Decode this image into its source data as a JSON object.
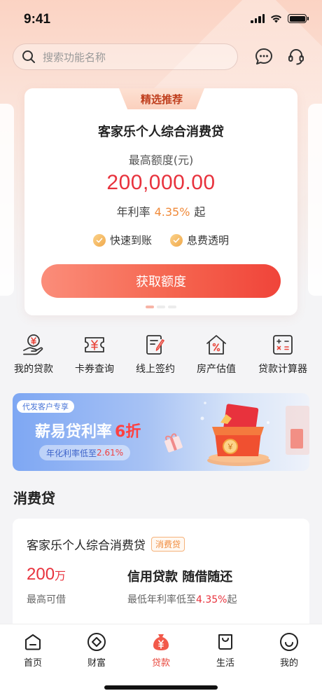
{
  "status_bar": {
    "time": "9:41"
  },
  "header": {
    "search_placeholder": "搜索功能名称",
    "icons": [
      "message-icon",
      "customer-service-icon"
    ]
  },
  "featured": {
    "ribbon": "精选推荐",
    "title": "客家乐个人综合消费贷",
    "limit_label": "最高额度(元)",
    "amount": "200,000.00",
    "rate_prefix": "年利率",
    "rate_value": "4.35%",
    "rate_suffix": "起",
    "features": [
      {
        "label": "快速到账"
      },
      {
        "label": "息费透明"
      }
    ],
    "cta_label": "获取额度",
    "page_count": 3,
    "active_page": 1
  },
  "quick_actions": [
    {
      "label": "我的贷款",
      "icon": "hand-yuan-icon"
    },
    {
      "label": "卡券查询",
      "icon": "coupon-icon"
    },
    {
      "label": "线上签约",
      "icon": "sign-document-icon"
    },
    {
      "label": "房产估值",
      "icon": "house-percent-icon"
    },
    {
      "label": "贷款计算器",
      "icon": "calculator-icon"
    }
  ],
  "banner": {
    "tag": "代发客户专享",
    "headline": "薪易贷利率",
    "discount": "6折",
    "sub_prefix": "年化利率低至",
    "sub_value": "2.61%"
  },
  "section": {
    "title": "消费贷"
  },
  "product": {
    "name": "客家乐个人综合消费贷",
    "badge": "消费贷",
    "amount": "200",
    "amount_unit": "万",
    "amount_label": "最高可借",
    "slogan": "信用贷款 随借随还",
    "rate_prefix": "最低年利率低至",
    "rate_value": "4.35%",
    "rate_suffix": "起"
  },
  "tabbar": {
    "active": "贷款",
    "tabs": [
      {
        "label": "首页",
        "icon": "home-icon"
      },
      {
        "label": "财富",
        "icon": "wealth-icon"
      },
      {
        "label": "贷款",
        "icon": "loan-bag-icon"
      },
      {
        "label": "生活",
        "icon": "shopping-bag-icon"
      },
      {
        "label": "我的",
        "icon": "smile-icon"
      }
    ]
  },
  "colors": {
    "accent_red": "#e8323d",
    "accent_orange": "#f08a3a",
    "cta_gradient_start": "#fb8d7a",
    "cta_gradient_end": "#f0443a"
  }
}
